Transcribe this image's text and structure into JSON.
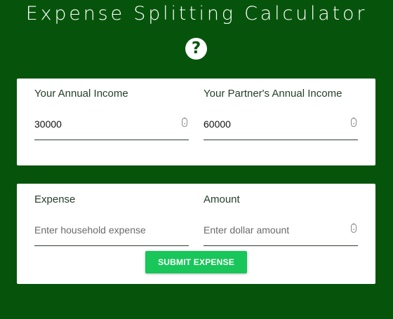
{
  "page": {
    "title": "Expense Splitting Calculator",
    "help_glyph": "?",
    "help_icon": "question-circle-icon"
  },
  "income": {
    "your": {
      "label": "Your Annual Income",
      "value": "30000"
    },
    "partner": {
      "label": "Your Partner's Annual Income",
      "value": "60000"
    }
  },
  "expense": {
    "name": {
      "label": "Expense",
      "placeholder": "Enter household expense"
    },
    "amount": {
      "label": "Amount",
      "placeholder": "Enter dollar amount"
    },
    "submit_label": "SUBMIT EXPENSE"
  },
  "colors": {
    "background": "#06540b",
    "card": "#ffffff",
    "submit": "#18c65a"
  }
}
